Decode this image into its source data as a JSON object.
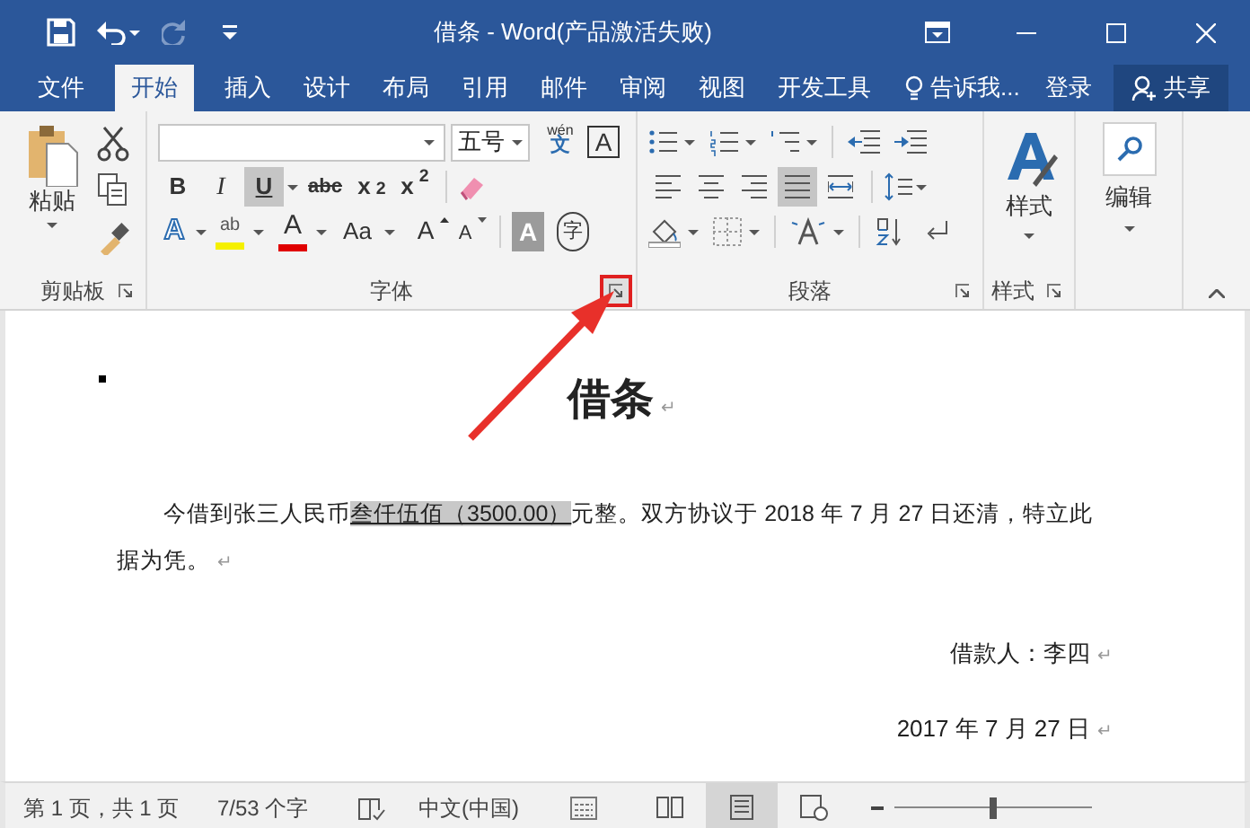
{
  "window": {
    "title": "借条 - Word(产品激活失败)"
  },
  "tabs": [
    {
      "label": "文件",
      "selected": false
    },
    {
      "label": "开始",
      "selected": true
    },
    {
      "label": "插入",
      "selected": false
    },
    {
      "label": "设计",
      "selected": false
    },
    {
      "label": "布局",
      "selected": false
    },
    {
      "label": "引用",
      "selected": false
    },
    {
      "label": "邮件",
      "selected": false
    },
    {
      "label": "审阅",
      "selected": false
    },
    {
      "label": "视图",
      "selected": false
    },
    {
      "label": "开发工具",
      "selected": false
    }
  ],
  "tell_me": "告诉我...",
  "sign_in": "登录",
  "share": "共享",
  "ribbon": {
    "clipboard": {
      "paste": "粘贴",
      "group": "剪贴板"
    },
    "font": {
      "size": "五号",
      "phonetic_top": "wén",
      "phonetic_bottom": "文",
      "border_char": "A",
      "bold": "B",
      "italic": "I",
      "underline": "U",
      "underline_selected": true,
      "strike": "abc",
      "subscript": "x$_{2}$",
      "superscript": "x$^{2}$",
      "effects": "A",
      "highlight": "ab",
      "color_letter": "A",
      "case": "Aa",
      "grow": "A",
      "shrink": "A",
      "shading": "A",
      "enclose": "字",
      "group": "字体"
    },
    "paragraph": {
      "align": [
        {
          "selected": false
        },
        {
          "selected": false
        },
        {
          "selected": false
        },
        {
          "selected": true
        },
        {
          "selected": false
        }
      ],
      "group": "段落"
    },
    "styles": {
      "button": "样式",
      "group": "样式"
    },
    "editing": {
      "button": "编辑"
    }
  },
  "document": {
    "paragraphs": [
      {
        "kind": "title",
        "parts": [
          {
            "text": "借条",
            "selected": false
          }
        ],
        "end_mark": "↵"
      },
      {
        "kind": "body",
        "parts": [
          {
            "text": "今借到张三人民币",
            "selected": false
          },
          {
            "text": "叁仟伍佰（3500.00）",
            "selected": true
          },
          {
            "text": "元整。双方协议于 2018 年 7 月 27 日还清，特立此据为凭。",
            "selected": false
          }
        ],
        "end_mark": "↵"
      },
      {
        "kind": "right",
        "parts": [
          {
            "text": "借款人：李四",
            "selected": false
          }
        ],
        "end_mark": "↵"
      },
      {
        "kind": "right",
        "parts": [
          {
            "text": "2017 年 7 月 27 日",
            "selected": false
          }
        ],
        "end_mark": "↵"
      }
    ]
  },
  "status_bar": {
    "page": "第 1 页，共 1 页",
    "words": "7/53 个字",
    "language": "中文(中国)",
    "zoom": {
      "level": 0.5
    },
    "views": [
      {
        "selected": false
      },
      {
        "selected": true
      },
      {
        "selected": false
      }
    ]
  }
}
